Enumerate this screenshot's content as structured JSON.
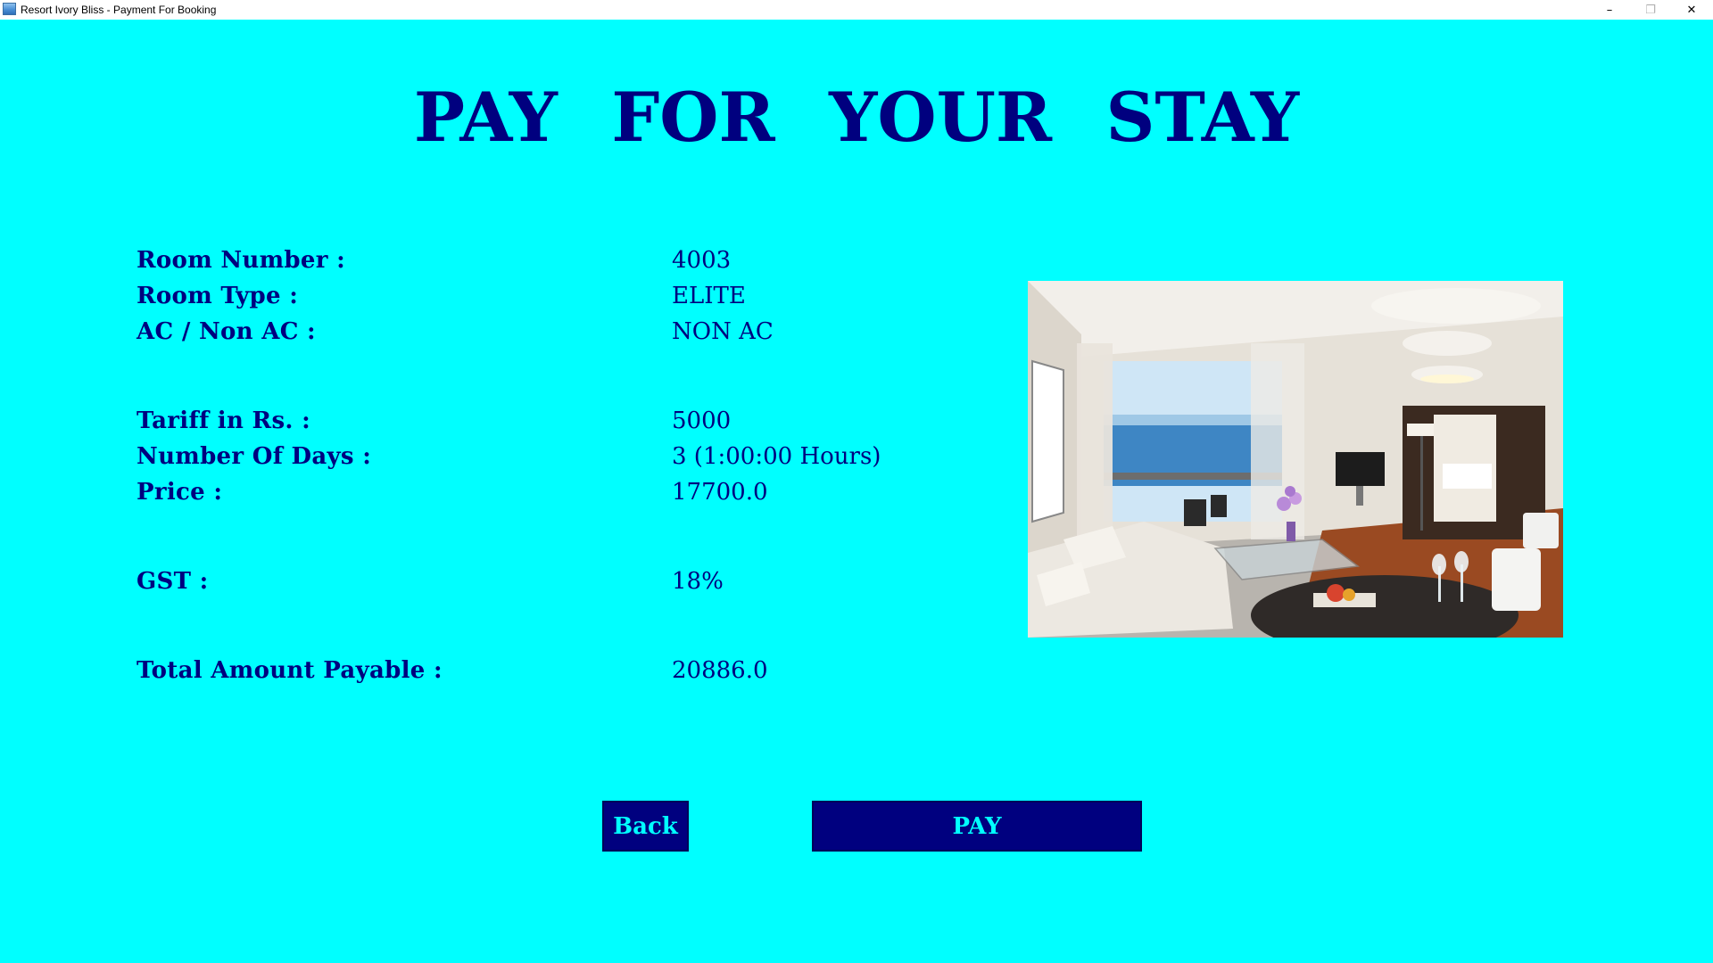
{
  "window": {
    "title": "Resort Ivory Bliss - Payment For Booking",
    "minimize_glyph": "–",
    "maximize_glyph": "❐",
    "close_glyph": "✕"
  },
  "page": {
    "title": "PAY FOR YOUR STAY"
  },
  "details": {
    "room_number_label": "Room Number :",
    "room_number": "4003",
    "room_type_label": "Room Type :",
    "room_type": "ELITE",
    "ac_label": "AC / Non AC :",
    "ac": "NON AC",
    "tariff_label": "Tariff in Rs.  :",
    "tariff": "5000",
    "days_label": "Number Of Days :",
    "days": "3 (1:00:00 Hours)",
    "price_label": "Price :",
    "price": "17700.0",
    "gst_label": "GST :",
    "gst": "18%",
    "total_label": "Total Amount Payable :",
    "total": "20886.0"
  },
  "buttons": {
    "back": "Back",
    "pay": "PAY"
  },
  "colors": {
    "background": "#00ffff",
    "text": "#00007f",
    "button_bg": "#00007f",
    "button_text": "#00ffff"
  },
  "icons": {
    "app": "app-icon",
    "minimize": "minimize-icon",
    "maximize": "maximize-icon",
    "close": "close-icon"
  }
}
